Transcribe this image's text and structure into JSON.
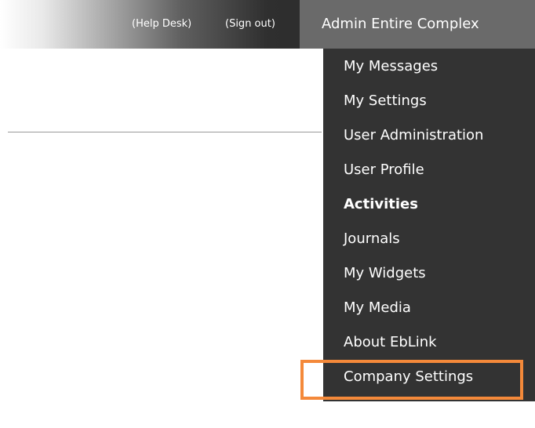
{
  "header": {
    "help_desk_label": "(Help Desk)",
    "sign_out_label": "(Sign out)",
    "user_menu_label": "Admin Entire Complex"
  },
  "menu": {
    "items": [
      {
        "label": "My Messages"
      },
      {
        "label": "My Settings"
      },
      {
        "label": "User Administration"
      },
      {
        "label": "User Profile"
      },
      {
        "label": "Activities"
      },
      {
        "label": "Journals"
      },
      {
        "label": "My Widgets"
      },
      {
        "label": "My Media"
      },
      {
        "label": "About EbLink"
      },
      {
        "label": "Company Settings"
      }
    ]
  },
  "colors": {
    "header_dark": "#242424",
    "active_tab": "#6a6a6a",
    "menu_background": "#333333",
    "highlight": "#f4893a"
  }
}
